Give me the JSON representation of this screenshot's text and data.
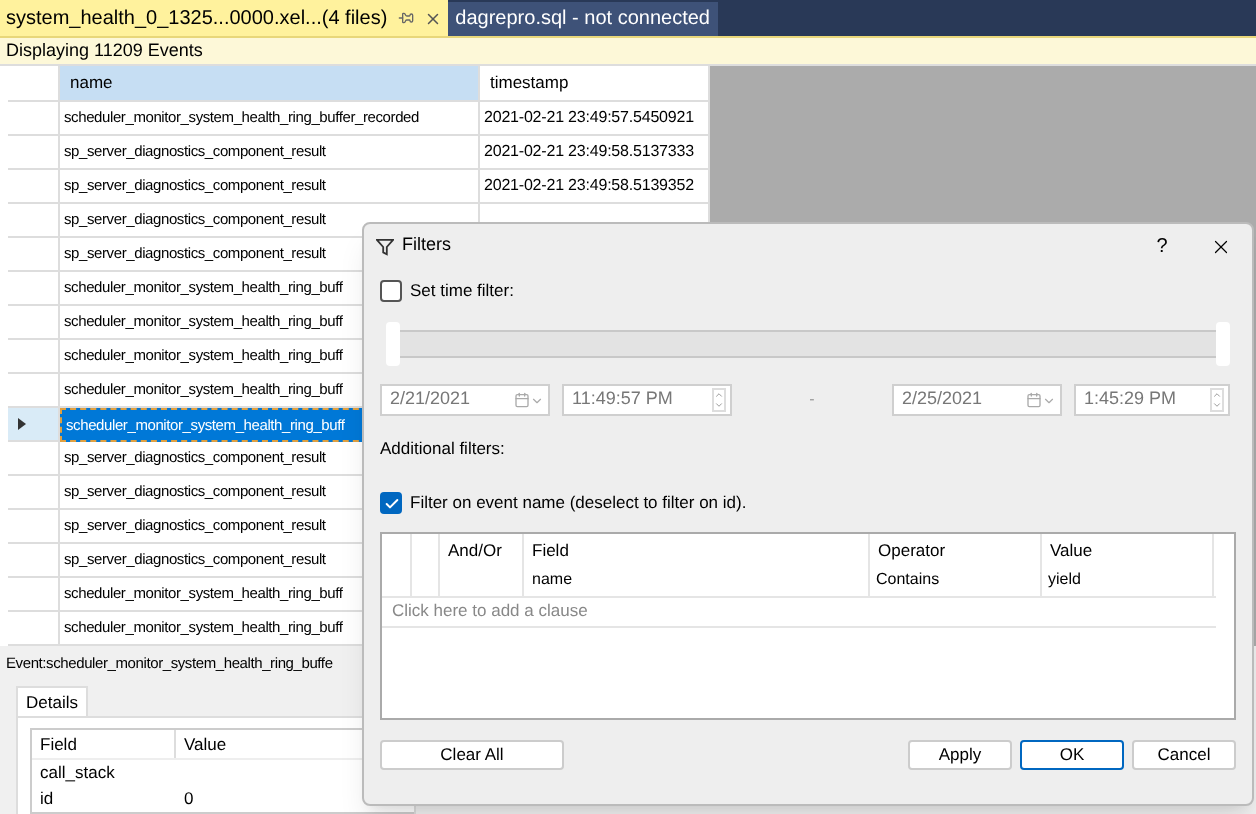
{
  "tabs": [
    {
      "label": "system_health_0_1325...0000.xel...(4 files)",
      "selected": true
    },
    {
      "label": "dagrepro.sql - not connected",
      "selected": false
    }
  ],
  "info_bar": "Displaying 11209 Events",
  "events_table": {
    "columns": [
      {
        "label": "name",
        "selected": true
      },
      {
        "label": "timestamp",
        "selected": false
      }
    ],
    "rows": [
      {
        "name": "scheduler_monitor_system_health_ring_buffer_recorded",
        "timestamp": "2021-02-21 23:49:57.5450921",
        "selected": false
      },
      {
        "name": "sp_server_diagnostics_component_result",
        "timestamp": "2021-02-21 23:49:58.5137333",
        "selected": false
      },
      {
        "name": "sp_server_diagnostics_component_result",
        "timestamp": "2021-02-21 23:49:58.5139352",
        "selected": false
      },
      {
        "name": "sp_server_diagnostics_component_result",
        "selected": false
      },
      {
        "name": "sp_server_diagnostics_component_result",
        "selected": false
      },
      {
        "name": "scheduler_monitor_system_health_ring_buff",
        "selected": false
      },
      {
        "name": "scheduler_monitor_system_health_ring_buff",
        "selected": false
      },
      {
        "name": "scheduler_monitor_system_health_ring_buff",
        "selected": false
      },
      {
        "name": "scheduler_monitor_system_health_ring_buff",
        "selected": false
      },
      {
        "name": "scheduler_monitor_system_health_ring_buff",
        "selected": true
      },
      {
        "name": "sp_server_diagnostics_component_result",
        "selected": false
      },
      {
        "name": "sp_server_diagnostics_component_result",
        "selected": false
      },
      {
        "name": "sp_server_diagnostics_component_result",
        "selected": false
      },
      {
        "name": "sp_server_diagnostics_component_result",
        "selected": false
      },
      {
        "name": "scheduler_monitor_system_health_ring_buff",
        "selected": false
      },
      {
        "name": "scheduler_monitor_system_health_ring_buff",
        "selected": false
      }
    ]
  },
  "event_detail": {
    "title": "Event:scheduler_monitor_system_health_ring_buffe",
    "tabs": [
      {
        "label": "Details",
        "selected": true
      }
    ],
    "columns": [
      "Field",
      "Value"
    ],
    "rows": [
      {
        "field": "call_stack"
      },
      {
        "field": "id",
        "value": "0"
      }
    ]
  },
  "filters_dialog": {
    "title": "Filters",
    "help": "?",
    "time_filter": {
      "label": "Set time filter:",
      "checked": false
    },
    "time_slider": {
      "handles": [
        {
          "level": 0
        },
        {
          "level": 1
        }
      ]
    },
    "start_date": "2/21/2021",
    "start_time": "11:49:57 PM",
    "range_separator": "-",
    "end_date": "2/25/2021",
    "end_time": "1:45:29 PM",
    "additional_filters_label": "Additional filters:",
    "event_name_filter": {
      "label": "Filter on event name (deselect to filter on id).",
      "checked": true
    },
    "clauses": {
      "columns": [
        "And/Or",
        "Field",
        "Operator",
        "Value"
      ],
      "rows": [
        {
          "field": "name",
          "operator": "Contains",
          "value": "yield"
        }
      ],
      "add_clause_hint": "Click here to add a clause"
    },
    "buttons": [
      {
        "label": "Clear All",
        "default": false
      },
      {
        "label": "Apply",
        "default": false
      },
      {
        "label": "OK",
        "default": true
      },
      {
        "label": "Cancel",
        "default": false
      }
    ]
  }
}
